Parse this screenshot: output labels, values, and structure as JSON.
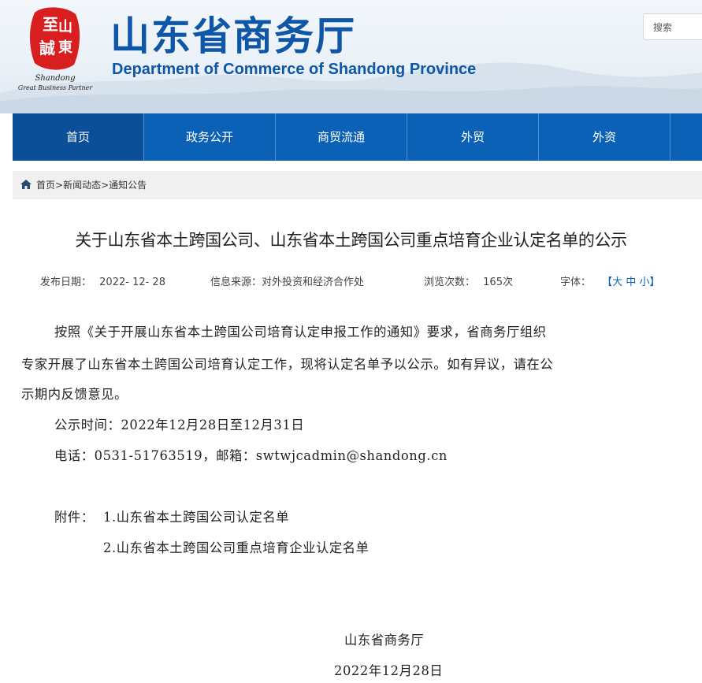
{
  "header": {
    "logo_seal_text": "至诚山东",
    "logo_brand": "Shandong",
    "logo_tagline": "Great Business Partner",
    "title": "山东省商务厅",
    "subtitle": "Department of Commerce of Shandong Province",
    "search_placeholder": "搜索",
    "brand_color": "#0e57a8"
  },
  "nav": {
    "items": [
      "首页",
      "政务公开",
      "商贸流通",
      "外贸",
      "外资"
    ],
    "active_index": 0,
    "color": "#0b61b5"
  },
  "breadcrumb": {
    "icon": "home-icon",
    "items": [
      "首页",
      "新闻动态",
      "通知公告"
    ],
    "separator": ">"
  },
  "article": {
    "title": "关于山东省本土跨国公司、山东省本土跨国公司重点培育企业认定名单的公示",
    "meta": {
      "publish_label": "发布日期：",
      "publish_date": "2022- 12- 28",
      "source_label": "信息来源：",
      "source": "对外投资和经济合作处",
      "views_label": "浏览次数：",
      "views": "165次",
      "font_label": "字体：",
      "font_open": "【",
      "font_large": "大",
      "font_medium": "中",
      "font_small": "小",
      "font_close": "】"
    },
    "paragraph_line1": "按照《关于开展山东省本土跨国公司培育认定申报工作的通知》要求，省商务厅组织",
    "paragraph_line2": "专家开展了山东省本土跨国公司培育认定工作，现将认定名单予以公示。如有异议，请在公",
    "paragraph_line3": "示期内反馈意见。",
    "notice_period": "公示时间：2022年12月28日至12月31日",
    "contact": "电话：0531-51763519，邮箱：swtwjcadmin@shandong.cn",
    "attachments_label": "附件：",
    "attachments": [
      "1.山东省本土跨国公司认定名单",
      "2.山东省本土跨国公司重点培育企业认定名单"
    ],
    "signature_org": "山东省商务厅",
    "signature_date": "2022年12月28日"
  }
}
